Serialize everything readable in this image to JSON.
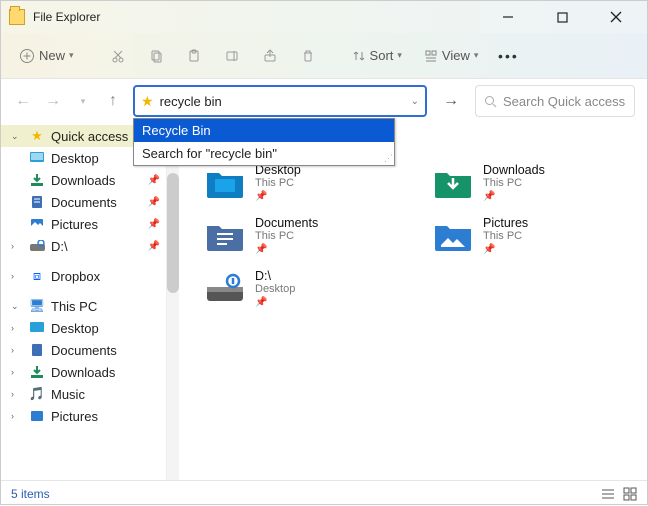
{
  "window": {
    "title": "File Explorer"
  },
  "toolbar": {
    "new": "New",
    "sort": "Sort",
    "view": "View"
  },
  "nav": {
    "address_value": "recycle bin",
    "search_placeholder": "Search Quick access"
  },
  "dropdown": {
    "item1": "Recycle Bin",
    "item2": "Search for \"recycle bin\""
  },
  "sidebar": {
    "quick": "Quick access",
    "desktop": "Desktop",
    "downloads": "Downloads",
    "documents": "Documents",
    "pictures": "Pictures",
    "d_drive": "D:\\",
    "dropbox": "Dropbox",
    "this_pc": "This PC",
    "pc_desktop": "Desktop",
    "pc_documents": "Documents",
    "pc_downloads": "Downloads",
    "pc_music": "Music",
    "pc_pictures": "Pictures"
  },
  "tiles": {
    "desktop": {
      "name": "Desktop",
      "sub": "This PC"
    },
    "downloads": {
      "name": "Downloads",
      "sub": "This PC"
    },
    "documents": {
      "name": "Documents",
      "sub": "This PC"
    },
    "pictures": {
      "name": "Pictures",
      "sub": "This PC"
    },
    "d_drive": {
      "name": "D:\\",
      "sub": "Desktop"
    }
  },
  "status": {
    "count": "5 items"
  }
}
